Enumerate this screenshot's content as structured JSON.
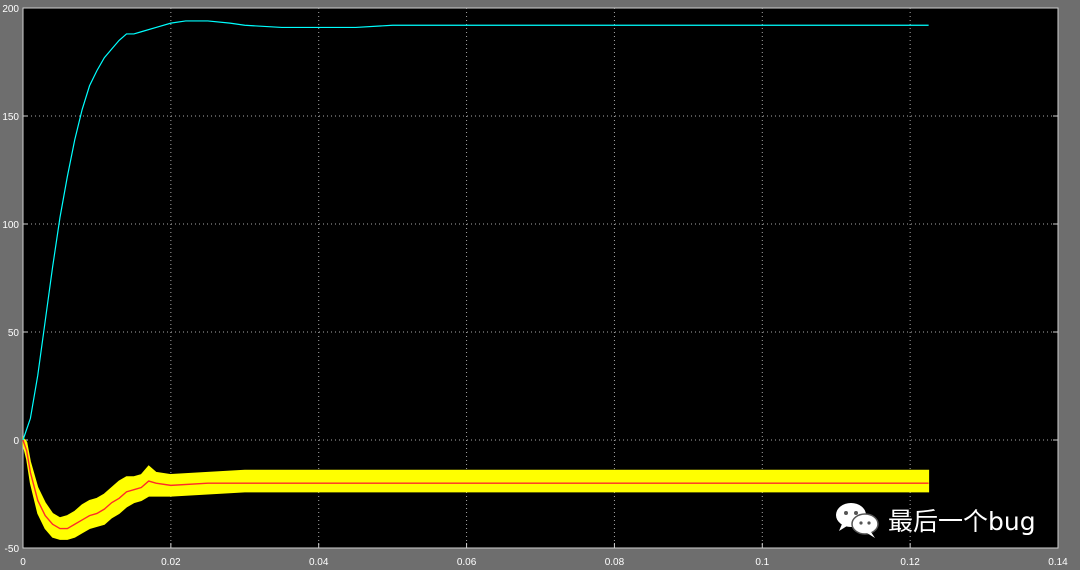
{
  "chart_data": {
    "type": "line",
    "title": "",
    "xlabel": "",
    "ylabel": "",
    "xlim": [
      0,
      0.14
    ],
    "ylim": [
      -50,
      200
    ],
    "x_ticks": [
      0,
      0.02,
      0.04,
      0.06,
      0.08,
      0.1,
      0.12,
      0.14
    ],
    "y_ticks": [
      -50,
      0,
      50,
      100,
      150,
      200
    ],
    "x_tick_labels": [
      "0",
      "0.02",
      "0.04",
      "0.06",
      "0.08",
      "0.1",
      "0.12",
      "0.14"
    ],
    "y_tick_labels": [
      "-50",
      "0",
      "50",
      "100",
      "150",
      "200"
    ],
    "grid": true,
    "background": "#000000",
    "series": [
      {
        "color": "#00ffff",
        "style": "line",
        "points": [
          [
            0,
            0
          ],
          [
            0.001,
            10
          ],
          [
            0.002,
            30
          ],
          [
            0.003,
            55
          ],
          [
            0.004,
            80
          ],
          [
            0.005,
            103
          ],
          [
            0.006,
            122
          ],
          [
            0.007,
            139
          ],
          [
            0.008,
            153
          ],
          [
            0.009,
            164
          ],
          [
            0.01,
            171
          ],
          [
            0.011,
            177
          ],
          [
            0.012,
            181
          ],
          [
            0.013,
            185
          ],
          [
            0.014,
            188
          ],
          [
            0.015,
            188
          ],
          [
            0.016,
            189
          ],
          [
            0.018,
            191
          ],
          [
            0.02,
            193
          ],
          [
            0.022,
            194
          ],
          [
            0.025,
            194
          ],
          [
            0.028,
            193
          ],
          [
            0.03,
            192
          ],
          [
            0.035,
            191
          ],
          [
            0.04,
            191
          ],
          [
            0.045,
            191
          ],
          [
            0.05,
            192
          ],
          [
            0.06,
            192
          ],
          [
            0.07,
            192
          ],
          [
            0.08,
            192
          ],
          [
            0.09,
            192
          ],
          [
            0.1,
            192
          ],
          [
            0.11,
            192
          ],
          [
            0.1225,
            192
          ]
        ]
      },
      {
        "color": "#ff2a2a",
        "style": "mean-line",
        "points": [
          [
            0,
            0
          ],
          [
            0.0005,
            -5
          ],
          [
            0.001,
            -15
          ],
          [
            0.002,
            -28
          ],
          [
            0.003,
            -35
          ],
          [
            0.004,
            -39
          ],
          [
            0.005,
            -41
          ],
          [
            0.006,
            -41
          ],
          [
            0.007,
            -39
          ],
          [
            0.008,
            -37
          ],
          [
            0.009,
            -35
          ],
          [
            0.01,
            -34
          ],
          [
            0.011,
            -32
          ],
          [
            0.012,
            -29
          ],
          [
            0.013,
            -27
          ],
          [
            0.014,
            -24
          ],
          [
            0.015,
            -23
          ],
          [
            0.016,
            -22
          ],
          [
            0.017,
            -19
          ],
          [
            0.018,
            -20
          ],
          [
            0.02,
            -21
          ],
          [
            0.025,
            -20
          ],
          [
            0.03,
            -20
          ],
          [
            0.04,
            -20
          ],
          [
            0.06,
            -20
          ],
          [
            0.08,
            -20
          ],
          [
            0.1,
            -20
          ],
          [
            0.1225,
            -20
          ]
        ]
      },
      {
        "color": "#ffff00",
        "style": "ripple-envelope",
        "points": [
          [
            0,
            1,
            -2
          ],
          [
            0.0005,
            -1,
            -9
          ],
          [
            0.001,
            -10,
            -20
          ],
          [
            0.002,
            -22,
            -34
          ],
          [
            0.003,
            -29,
            -41
          ],
          [
            0.004,
            -34,
            -45
          ],
          [
            0.005,
            -36,
            -46
          ],
          [
            0.006,
            -35,
            -46
          ],
          [
            0.007,
            -33,
            -45
          ],
          [
            0.008,
            -30,
            -43
          ],
          [
            0.009,
            -28,
            -41
          ],
          [
            0.01,
            -27,
            -40
          ],
          [
            0.011,
            -25,
            -39
          ],
          [
            0.012,
            -22,
            -36
          ],
          [
            0.013,
            -19,
            -34
          ],
          [
            0.014,
            -17,
            -31
          ],
          [
            0.015,
            -17,
            -29
          ],
          [
            0.016,
            -16,
            -28
          ],
          [
            0.017,
            -12,
            -26
          ],
          [
            0.018,
            -15,
            -26
          ],
          [
            0.02,
            -16,
            -26
          ],
          [
            0.025,
            -15,
            -25
          ],
          [
            0.03,
            -14,
            -24
          ],
          [
            0.04,
            -14,
            -24
          ],
          [
            0.06,
            -14,
            -24
          ],
          [
            0.08,
            -14,
            -24
          ],
          [
            0.1,
            -14,
            -24
          ],
          [
            0.1225,
            -14,
            -24
          ]
        ]
      }
    ]
  },
  "watermark": {
    "text": "最后一个bug",
    "icon": "wechat-icon"
  }
}
